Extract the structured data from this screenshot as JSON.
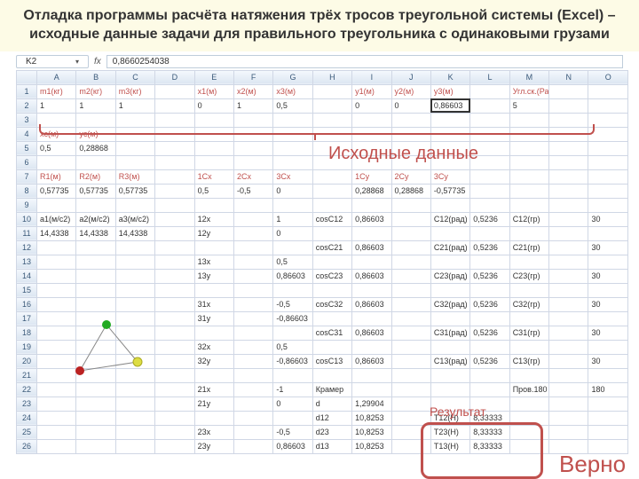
{
  "title": "Отладка программы расчёта натяжения трёх тросов треугольной системы (Excel) – исходные данные задачи для правильного треугольника с одинаковыми грузами",
  "namebox": "K2",
  "fx": "0,8660254038",
  "cols": [
    "",
    "A",
    "B",
    "C",
    "D",
    "E",
    "F",
    "G",
    "H",
    "I",
    "J",
    "K",
    "L",
    "M",
    "N",
    "O"
  ],
  "rows": [
    {
      "n": "1",
      "c": [
        "m1(кг)",
        "m2(кг)",
        "m3(кг)",
        "",
        "x1(м)",
        "x2(м)",
        "x3(м)",
        "",
        "y1(м)",
        "y2(м)",
        "y3(м)",
        "",
        "Угл.ск.(Рад/с)",
        "",
        ""
      ],
      "cls": "hdr"
    },
    {
      "n": "2",
      "c": [
        "1",
        "1",
        "1",
        "",
        "0",
        "1",
        "0,5",
        "",
        "0",
        "0",
        "0,86603",
        "",
        "5",
        "",
        ""
      ]
    },
    {
      "n": "3",
      "c": [
        "",
        "",
        "",
        "",
        "",
        "",
        "",
        "",
        "",
        "",
        "",
        "",
        "",
        "",
        ""
      ]
    },
    {
      "n": "4",
      "c": [
        "xc(м)",
        "yc(м)",
        "",
        "",
        "",
        "",
        "",
        "",
        "",
        "",
        "",
        "",
        "",
        "",
        ""
      ],
      "cls": "hdr"
    },
    {
      "n": "5",
      "c": [
        "0,5",
        "0,28868",
        "",
        "",
        "",
        "",
        "",
        "",
        "",
        "",
        "",
        "",
        "",
        "",
        ""
      ]
    },
    {
      "n": "6",
      "c": [
        "",
        "",
        "",
        "",
        "",
        "",
        "",
        "",
        "",
        "",
        "",
        "",
        "",
        "",
        ""
      ]
    },
    {
      "n": "7",
      "c": [
        "R1(м)",
        "R2(м)",
        "R3(м)",
        "",
        "1Cx",
        "2Cx",
        "3Cx",
        "",
        "1Cy",
        "2Cy",
        "3Cy",
        "",
        "",
        "",
        ""
      ],
      "cls": "hdr"
    },
    {
      "n": "8",
      "c": [
        "0,57735",
        "0,57735",
        "0,57735",
        "",
        "0,5",
        "-0,5",
        "0",
        "",
        "0,28868",
        "0,28868",
        "-0,57735",
        "",
        "",
        "",
        ""
      ]
    },
    {
      "n": "9",
      "c": [
        "",
        "",
        "",
        "",
        "",
        "",
        "",
        "",
        "",
        "",
        "",
        "",
        "",
        "",
        ""
      ]
    },
    {
      "n": "10",
      "c": [
        "a1(м/c2)",
        "a2(м/c2)",
        "a3(м/c2)",
        "",
        "12x",
        "",
        "1",
        "cosC12",
        "0,86603",
        "",
        "C12(рад)",
        "0,5236",
        "C12(гр)",
        "",
        "30"
      ]
    },
    {
      "n": "11",
      "c": [
        "14,4338",
        "14,4338",
        "14,4338",
        "",
        "12y",
        "",
        "0",
        "",
        "",
        "",
        "",
        "",
        "",
        "",
        ""
      ]
    },
    {
      "n": "12",
      "c": [
        "",
        "",
        "",
        "",
        "",
        "",
        "",
        "cosC21",
        "0,86603",
        "",
        "C21(рад)",
        "0,5236",
        "C21(гр)",
        "",
        "30"
      ]
    },
    {
      "n": "13",
      "c": [
        "",
        "",
        "",
        "",
        "13x",
        "",
        "0,5",
        "",
        "",
        "",
        "",
        "",
        "",
        "",
        ""
      ]
    },
    {
      "n": "14",
      "c": [
        "",
        "",
        "",
        "",
        "13y",
        "",
        "0,86603",
        "cosC23",
        "0,86603",
        "",
        "C23(рад)",
        "0,5236",
        "C23(гр)",
        "",
        "30"
      ]
    },
    {
      "n": "15",
      "c": [
        "",
        "",
        "",
        "",
        "",
        "",
        "",
        "",
        "",
        "",
        "",
        "",
        "",
        "",
        ""
      ]
    },
    {
      "n": "16",
      "c": [
        "",
        "",
        "",
        "",
        "31x",
        "",
        "-0,5",
        "cosC32",
        "0,86603",
        "",
        "C32(рад)",
        "0,5236",
        "C32(гр)",
        "",
        "30"
      ]
    },
    {
      "n": "17",
      "c": [
        "",
        "",
        "",
        "",
        "31y",
        "",
        "-0,86603",
        "",
        "",
        "",
        "",
        "",
        "",
        "",
        ""
      ]
    },
    {
      "n": "18",
      "c": [
        "",
        "",
        "",
        "",
        "",
        "",
        "",
        "cosC31",
        "0,86603",
        "",
        "C31(рад)",
        "0,5236",
        "C31(гр)",
        "",
        "30"
      ]
    },
    {
      "n": "19",
      "c": [
        "",
        "",
        "",
        "",
        "32x",
        "",
        "0,5",
        "",
        "",
        "",
        "",
        "",
        "",
        "",
        ""
      ]
    },
    {
      "n": "20",
      "c": [
        "",
        "",
        "",
        "",
        "32y",
        "",
        "-0,86603",
        "cosC13",
        "0,86603",
        "",
        "C13(рад)",
        "0,5236",
        "C13(гр)",
        "",
        "30"
      ]
    },
    {
      "n": "21",
      "c": [
        "",
        "",
        "",
        "",
        "",
        "",
        "",
        "",
        "",
        "",
        "",
        "",
        "",
        "",
        ""
      ]
    },
    {
      "n": "22",
      "c": [
        "",
        "",
        "",
        "",
        "21x",
        "",
        "-1",
        "Крамер",
        "",
        "",
        "",
        "",
        "Пров.180",
        "",
        "180"
      ]
    },
    {
      "n": "23",
      "c": [
        "",
        "",
        "",
        "",
        "21y",
        "",
        "0",
        "d",
        "1,29904",
        "",
        "",
        "",
        "",
        "",
        ""
      ]
    },
    {
      "n": "24",
      "c": [
        "",
        "",
        "",
        "",
        "",
        "",
        "",
        "d12",
        "10,8253",
        "",
        "T12(H)",
        "8,33333",
        "",
        "",
        ""
      ]
    },
    {
      "n": "25",
      "c": [
        "",
        "",
        "",
        "",
        "23x",
        "",
        "-0,5",
        "d23",
        "10,8253",
        "",
        "T23(H)",
        "8,33333",
        "",
        "",
        ""
      ]
    },
    {
      "n": "26",
      "c": [
        "",
        "",
        "",
        "",
        "23y",
        "",
        "0,86603",
        "d13",
        "10,8253",
        "",
        "T13(H)",
        "8,33333",
        "",
        "",
        ""
      ]
    }
  ],
  "ann": {
    "src": "Исходные данные",
    "res": "Результат",
    "verno": "Верно"
  }
}
